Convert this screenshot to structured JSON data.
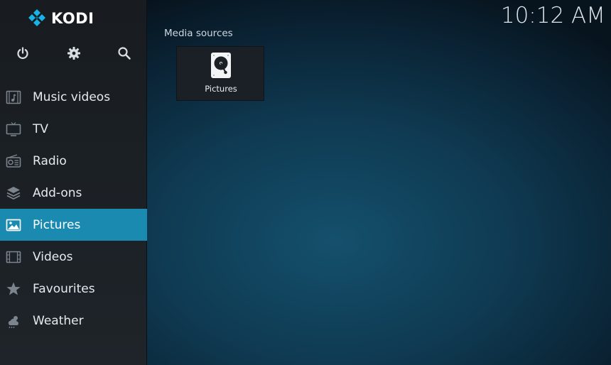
{
  "app": {
    "name": "KODI",
    "clock": "10:12 AM"
  },
  "top_buttons": [
    {
      "icon": "power-icon"
    },
    {
      "icon": "gear-icon"
    },
    {
      "icon": "search-icon"
    }
  ],
  "nav": {
    "items": [
      {
        "label": "Music videos",
        "icon": "music-video-icon"
      },
      {
        "label": "TV",
        "icon": "tv-icon"
      },
      {
        "label": "Radio",
        "icon": "radio-icon"
      },
      {
        "label": "Add-ons",
        "icon": "addons-icon"
      },
      {
        "label": "Pictures",
        "icon": "pictures-icon",
        "active": true
      },
      {
        "label": "Videos",
        "icon": "film-icon"
      },
      {
        "label": "Favourites",
        "icon": "star-icon"
      },
      {
        "label": "Weather",
        "icon": "weather-icon"
      }
    ]
  },
  "main": {
    "section_title": "Media sources",
    "sources": [
      {
        "label": "Pictures",
        "icon": "hard-drive-icon"
      }
    ]
  },
  "colors": {
    "accent": "#1a8ab0",
    "sidebar": "#1c2126",
    "background": "#0f3a52"
  }
}
